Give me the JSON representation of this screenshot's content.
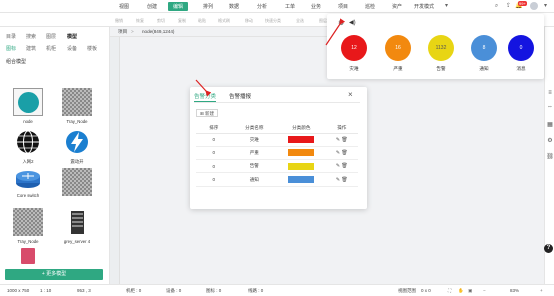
{
  "topnav": {
    "menus": [
      "视图",
      "创建",
      "编辑",
      "排列",
      "数据",
      "分析",
      "工单",
      "业务",
      "项目",
      "巡检",
      "资产",
      "开发模式"
    ],
    "active": "编辑",
    "badge": "99+"
  },
  "toolbar": {
    "items": [
      "撤销",
      "恢复",
      "剪切",
      "复制",
      "粘贴",
      "格式刷",
      "移动",
      "快速分类",
      "全选",
      "图层"
    ]
  },
  "sidebar": {
    "tabs_row1": [
      "目录",
      "搜索",
      "图层",
      "模型"
    ],
    "tabs_row2": [
      "图标",
      "建筑",
      "机柜",
      "设备",
      "楼板"
    ],
    "section": "组合模型",
    "models": [
      "node",
      "Tray_Node",
      "入网2",
      "震动开",
      "Core switch",
      "",
      "Tray_Node",
      "grey_server 4"
    ],
    "more_button": "+ 更多模型"
  },
  "breadcrumb": {
    "home": "项目",
    "path": "node(849,1244)"
  },
  "dialog": {
    "tabs": [
      "告警分类",
      "告警播报"
    ],
    "active_tab": "告警分类",
    "new_button": "新建",
    "headers": [
      "排序",
      "分类名称",
      "分类颜色",
      "操作"
    ],
    "rows": [
      {
        "order": "0",
        "name": "灾难",
        "color": "#e8181a"
      },
      {
        "order": "0",
        "name": "严重",
        "color": "#f2890f"
      },
      {
        "order": "0",
        "name": "告警",
        "color": "#e8d514"
      },
      {
        "order": "0",
        "name": "通知",
        "color": "#4a8fd8"
      }
    ]
  },
  "legend": {
    "items": [
      {
        "value": "12",
        "label": "灾难",
        "color": "#e8181a"
      },
      {
        "value": "16",
        "label": "严重",
        "color": "#f2890f"
      },
      {
        "value": "1132",
        "label": "告警",
        "color": "#e8d514"
      },
      {
        "value": "8",
        "label": "通知",
        "color": "#4a8fd8"
      },
      {
        "value": "0",
        "label": "消息",
        "color": "#1414e0"
      }
    ]
  },
  "statusbar": {
    "canvas_size": "1000 x 750",
    "ratio": "1 : 10",
    "coords": "953 , 3",
    "racks": "机柜 : 0",
    "devices": "设备 : 0",
    "icons": "图标 : 0",
    "lines": "线路 : 0",
    "view_range": "视图范围",
    "view_value": "0 x 0",
    "zoom": "83%"
  }
}
